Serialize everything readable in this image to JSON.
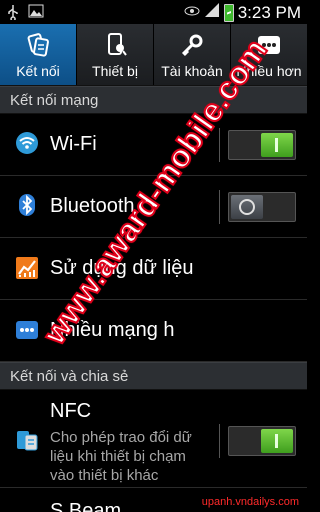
{
  "status_bar": {
    "time": "3:23 PM",
    "icons": [
      "usb-icon",
      "image-icon",
      "eye-icon",
      "signal-icon",
      "battery-charging-icon"
    ]
  },
  "tabs": [
    {
      "label": "Kết nối",
      "icon": "connections-icon",
      "active": true
    },
    {
      "label": "Thiết bị",
      "icon": "device-icon",
      "active": false
    },
    {
      "label": "Tài khoản",
      "icon": "key-icon",
      "active": false
    },
    {
      "label": "Nhiều hơn",
      "icon": "more-icon",
      "active": false
    }
  ],
  "sections": {
    "network": "Kết nối mạng",
    "share": "Kết nối và chia sẻ"
  },
  "rows": {
    "wifi": {
      "label": "Wi-Fi",
      "switch": "on"
    },
    "bluetooth": {
      "label": "Bluetooth",
      "switch": "off"
    },
    "data_usage": {
      "label": "Sử dụng dữ liệu"
    },
    "more_networks": {
      "label": "Nhiều mạng h"
    },
    "nfc": {
      "label": "NFC",
      "sub": "Cho phép trao đổi dữ liệu khi thiết bị chạm vào thiết bị khác",
      "switch": "on"
    },
    "sbeam": {
      "label": "S Beam"
    }
  },
  "watermark": {
    "text": "www.award-mobile.com",
    "credit": "upanh.vndailys.com"
  },
  "colors": {
    "accent": "#1a6fb0",
    "switch_on": "#5fc132",
    "watermark": "#e0001a"
  }
}
